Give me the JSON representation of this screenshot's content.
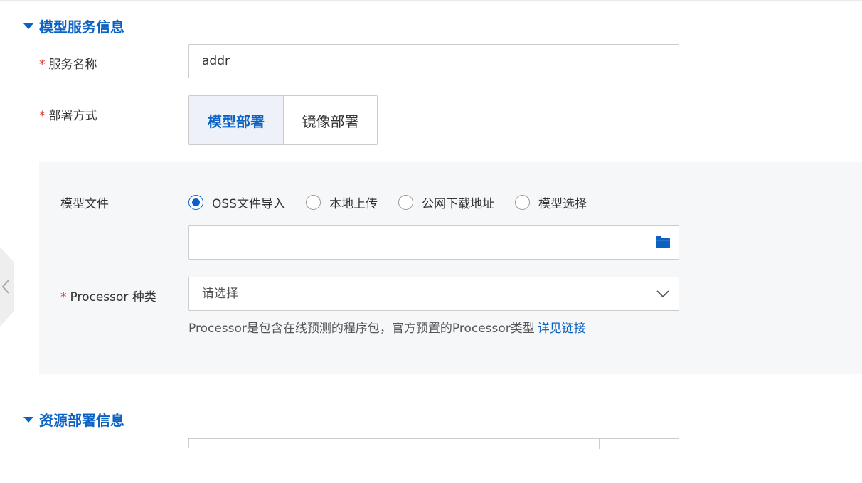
{
  "sections": {
    "model_service": {
      "title": "模型服务信息"
    },
    "resource_deploy": {
      "title": "资源部署信息"
    }
  },
  "service_name": {
    "label": "服务名称",
    "required_mark": "*",
    "value": "addr"
  },
  "deploy_method": {
    "label": "部署方式",
    "required_mark": "*",
    "options": [
      "模型部署",
      "镜像部署"
    ],
    "selected": "模型部署"
  },
  "model_file": {
    "label": "模型文件",
    "options": [
      "OSS文件导入",
      "本地上传",
      "公网下载地址",
      "模型选择"
    ],
    "selected": "OSS文件导入",
    "path_value": "",
    "folder_icon": "folder-icon"
  },
  "processor": {
    "label": "Processor 种类",
    "required_mark": "*",
    "placeholder": "请选择",
    "help_text": "Processor是包含在线预测的程序包，官方预置的Processor类型",
    "help_link": "详见链接"
  },
  "colors": {
    "accent": "#0b62c4",
    "required": "#e5322d",
    "panel_bg": "#f6f7f9",
    "border": "#cccccc"
  }
}
